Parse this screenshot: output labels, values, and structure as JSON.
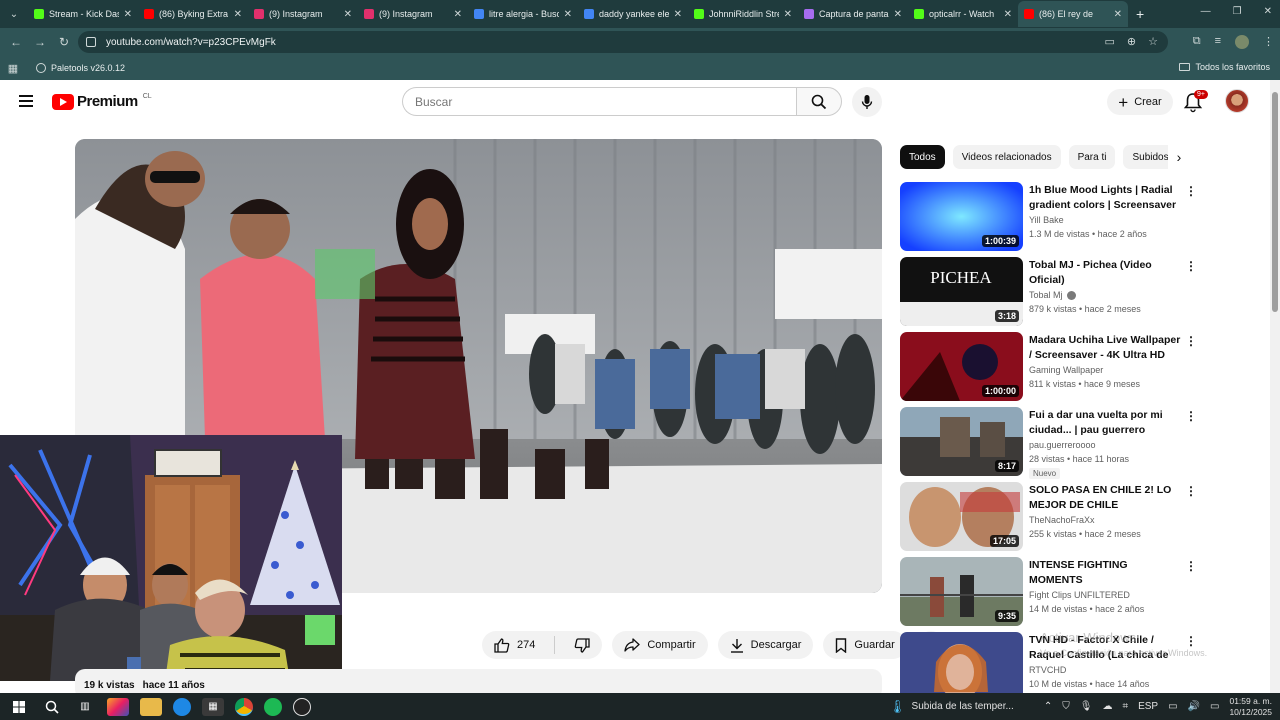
{
  "browser": {
    "tabs": [
      {
        "label": "Stream - Kick Das",
        "color": "#53fc18",
        "active": false
      },
      {
        "label": "(86) Byking Extra",
        "color": "#ff0000",
        "active": false
      },
      {
        "label": "(9) Instagram",
        "color": "#e1306c",
        "active": false
      },
      {
        "label": "(9) Instagram",
        "color": "#e1306c",
        "active": false
      },
      {
        "label": "litre alergia - Busc",
        "color": "#4285f4",
        "active": false
      },
      {
        "label": "daddy yankee ele",
        "color": "#4285f4",
        "active": false
      },
      {
        "label": "JohnniRiddlin Stre",
        "color": "#53fc18",
        "active": false
      },
      {
        "label": "Captura de panta",
        "color": "#a66cf0",
        "active": false
      },
      {
        "label": "opticalrr - Watch",
        "color": "#53fc18",
        "active": false
      },
      {
        "label": "(86) El rey de",
        "color": "#ff0000",
        "active": true
      }
    ],
    "url": "youtube.com/watch?v=p23CPEvMgFk",
    "bookmark": "Paletools v26.0.12",
    "all_bookmarks": "Todos los favoritos"
  },
  "header": {
    "brand": "Premium",
    "country": "CL",
    "search_placeholder": "Buscar",
    "create_label": "Crear",
    "notifications": "9+"
  },
  "video": {
    "likes": "274",
    "share_label": "Compartir",
    "download_label": "Descargar",
    "save_label": "Guardar",
    "views": "19 k vistas",
    "age": "hace 11 años"
  },
  "chips": [
    "Todos",
    "Videos relacionados",
    "Para ti",
    "Subidos"
  ],
  "recommendations": [
    {
      "title": "1h Blue Mood Lights | Radial gradient colors | Screensaver |...",
      "channel": "Yill Bake",
      "stats": "1.3 M de vistas • hace 2 años",
      "duration": "1:00:39",
      "verified": false,
      "new": false
    },
    {
      "title": "Tobal MJ - Pichea (Video Oficial)",
      "channel": "Tobal Mj",
      "stats": "879 k vistas • hace 2 meses",
      "duration": "3:18",
      "verified": true,
      "new": false
    },
    {
      "title": "Madara Uchiha Live Wallpaper / Screensaver - 4K Ultra HD",
      "channel": "Gaming Wallpaper",
      "stats": "811 k vistas • hace 9 meses",
      "duration": "1:00:00",
      "verified": false,
      "new": false
    },
    {
      "title": "Fui a dar una vuelta por mi ciudad...  | pau guerrero",
      "channel": "pau.guerreroooo",
      "stats": "28 vistas • hace 11 horas",
      "duration": "8:17",
      "verified": false,
      "new": true,
      "new_label": "Nuevo"
    },
    {
      "title": "SOLO PASA EN CHILE 2! LO MEJOR DE CHILE",
      "channel": "TheNachoFraXx",
      "stats": "255 k vistas • hace 2 meses",
      "duration": "17:05",
      "verified": false,
      "new": false
    },
    {
      "title": "INTENSE FIGHTING MOMENTS",
      "channel": "Fight Clips UNFILTERED",
      "stats": "14 M de vistas • hace 2 años",
      "duration": "9:35",
      "verified": false,
      "new": false
    },
    {
      "title": "TVN HD - Factor X Chile / Raquel Castillo (La chica de la...",
      "channel": "RTVCHD",
      "stats": "10 M de vistas • hace 14 años",
      "duration": "",
      "verified": false,
      "new": false
    }
  ],
  "thumb2_text": "PICHEA",
  "watermark": {
    "line1": "Activar Windows",
    "line2": "Ve a Configuración para activar Windows."
  },
  "taskbar": {
    "weather": "Subida de las temper...",
    "lang": "ESP",
    "time": "01:59 a. m.",
    "date": "10/12/2025"
  }
}
